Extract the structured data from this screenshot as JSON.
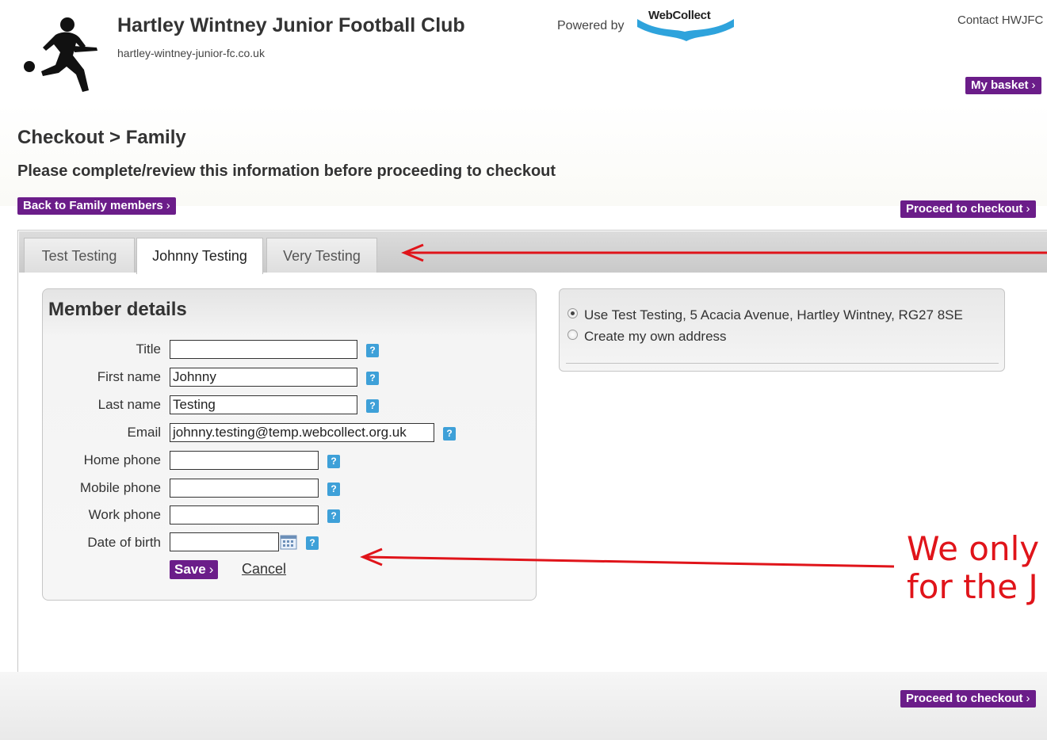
{
  "header": {
    "club_name": "Hartley Wintney Junior Football Club",
    "club_url": "hartley-wintney-junior-fc.co.uk",
    "powered_by": "Powered by",
    "webcollect": "WebCollect",
    "contact": "Contact HWJFC",
    "basket": "My basket"
  },
  "page": {
    "title": "Checkout > Family",
    "instruction": "Please complete/review this information before proceeding to checkout",
    "back_button": "Back to Family members",
    "proceed_button": "Proceed to checkout"
  },
  "tabs": [
    {
      "label": "Test Testing",
      "active": false
    },
    {
      "label": "Johnny Testing",
      "active": true
    },
    {
      "label": "Very Testing",
      "active": false
    }
  ],
  "member": {
    "heading": "Member details",
    "fields": [
      {
        "label": "Title",
        "value": ""
      },
      {
        "label": "First name",
        "value": "Johnny"
      },
      {
        "label": "Last name",
        "value": "Testing"
      },
      {
        "label": "Email",
        "value": "johnny.testing@temp.webcollect.org.uk"
      },
      {
        "label": "Home phone",
        "value": ""
      },
      {
        "label": "Mobile phone",
        "value": ""
      },
      {
        "label": "Work phone",
        "value": ""
      },
      {
        "label": "Date of birth",
        "value": ""
      }
    ],
    "help_glyph": "?",
    "save": "Save",
    "cancel": "Cancel"
  },
  "address": {
    "options": [
      {
        "label": "Use Test Testing, 5 Acacia Avenue, Hartley Wintney, RG27 8SE",
        "checked": true
      },
      {
        "label": "Create my own address",
        "checked": false
      }
    ]
  },
  "annotation": {
    "line1": "We only",
    "line2": "for the J",
    "color": "#e0141a"
  },
  "colors": {
    "accent": "#6b1d89",
    "help": "#3ea0d8"
  },
  "icons": {
    "chevron": "›",
    "calendar": "calendar-icon"
  }
}
